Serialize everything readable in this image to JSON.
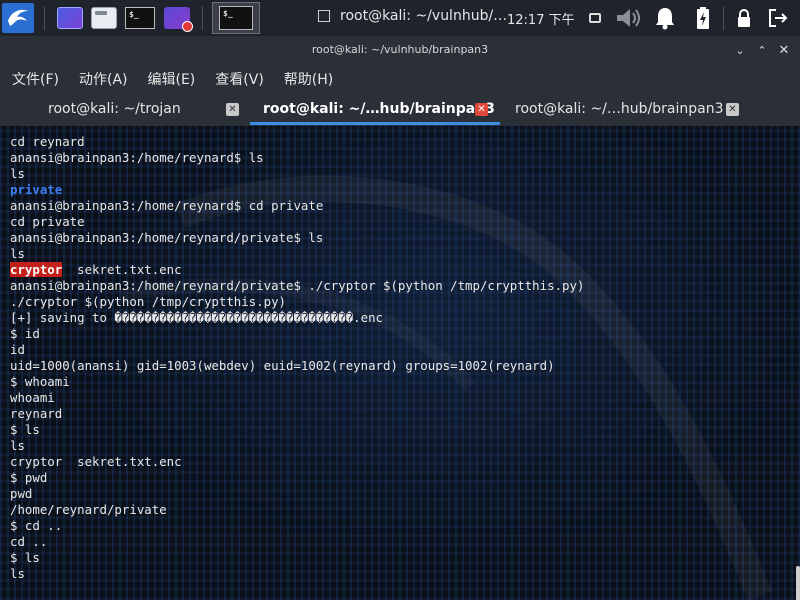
{
  "panel": {
    "taskbar_title": "root@kali: ~/vulnhub/…",
    "clock": "12:17 下午",
    "accent": "#2a6fd1"
  },
  "window": {
    "title": "root@kali: ~/vulnhub/brainpan3"
  },
  "menubar": {
    "items": [
      "文件(F)",
      "动作(A)",
      "编辑(E)",
      "查看(V)",
      "帮助(H)"
    ]
  },
  "tabs": [
    {
      "label": "root@kali: ~/trojan",
      "active": false
    },
    {
      "label": "root@kali: ~/…hub/brainpan3",
      "active": true
    },
    {
      "label": "root@kali: ~/…hub/brainpan3",
      "active": false
    }
  ],
  "terminal": {
    "lines": [
      [
        {
          "t": "cd reynard"
        }
      ],
      [
        {
          "t": "anansi@brainpan3:/home/reynard$ ls"
        }
      ],
      [
        {
          "t": "ls"
        }
      ],
      [
        {
          "t": "private",
          "c": "dir"
        }
      ],
      [
        {
          "t": "anansi@brainpan3:/home/reynard$ cd private"
        }
      ],
      [
        {
          "t": "cd private"
        }
      ],
      [
        {
          "t": "anansi@brainpan3:/home/reynard/private$ ls"
        }
      ],
      [
        {
          "t": "ls"
        }
      ],
      [
        {
          "t": "cryptor",
          "c": "exec"
        },
        {
          "t": "  sekret.txt.enc"
        }
      ],
      [
        {
          "t": "anansi@brainpan3:/home/reynard/private$ ./cryptor $(python /tmp/cryptthis.py)"
        }
      ],
      [
        {
          "t": "./cryptor $(python /tmp/cryptthis.py)"
        }
      ],
      [
        {
          "t": "[+] saving to ��������������������������������.enc"
        }
      ],
      [
        {
          "t": "$ id"
        }
      ],
      [
        {
          "t": "id"
        }
      ],
      [
        {
          "t": "uid=1000(anansi) gid=1003(webdev) euid=1002(reynard) groups=1002(reynard)"
        }
      ],
      [
        {
          "t": "$ whoami"
        }
      ],
      [
        {
          "t": "whoami"
        }
      ],
      [
        {
          "t": "reynard"
        }
      ],
      [
        {
          "t": "$ ls"
        }
      ],
      [
        {
          "t": "ls"
        }
      ],
      [
        {
          "t": "cryptor  sekret.txt.enc"
        }
      ],
      [
        {
          "t": "$ pwd"
        }
      ],
      [
        {
          "t": "pwd"
        }
      ],
      [
        {
          "t": "/home/reynard/private"
        }
      ],
      [
        {
          "t": "$ cd .."
        }
      ],
      [
        {
          "t": "cd .."
        }
      ],
      [
        {
          "t": "$ ls"
        }
      ],
      [
        {
          "t": "ls"
        }
      ]
    ]
  },
  "colors": {
    "directory": "#3d7ff0",
    "executable_bg": "#c3201b",
    "tab_underline": "#3b8ee5"
  }
}
